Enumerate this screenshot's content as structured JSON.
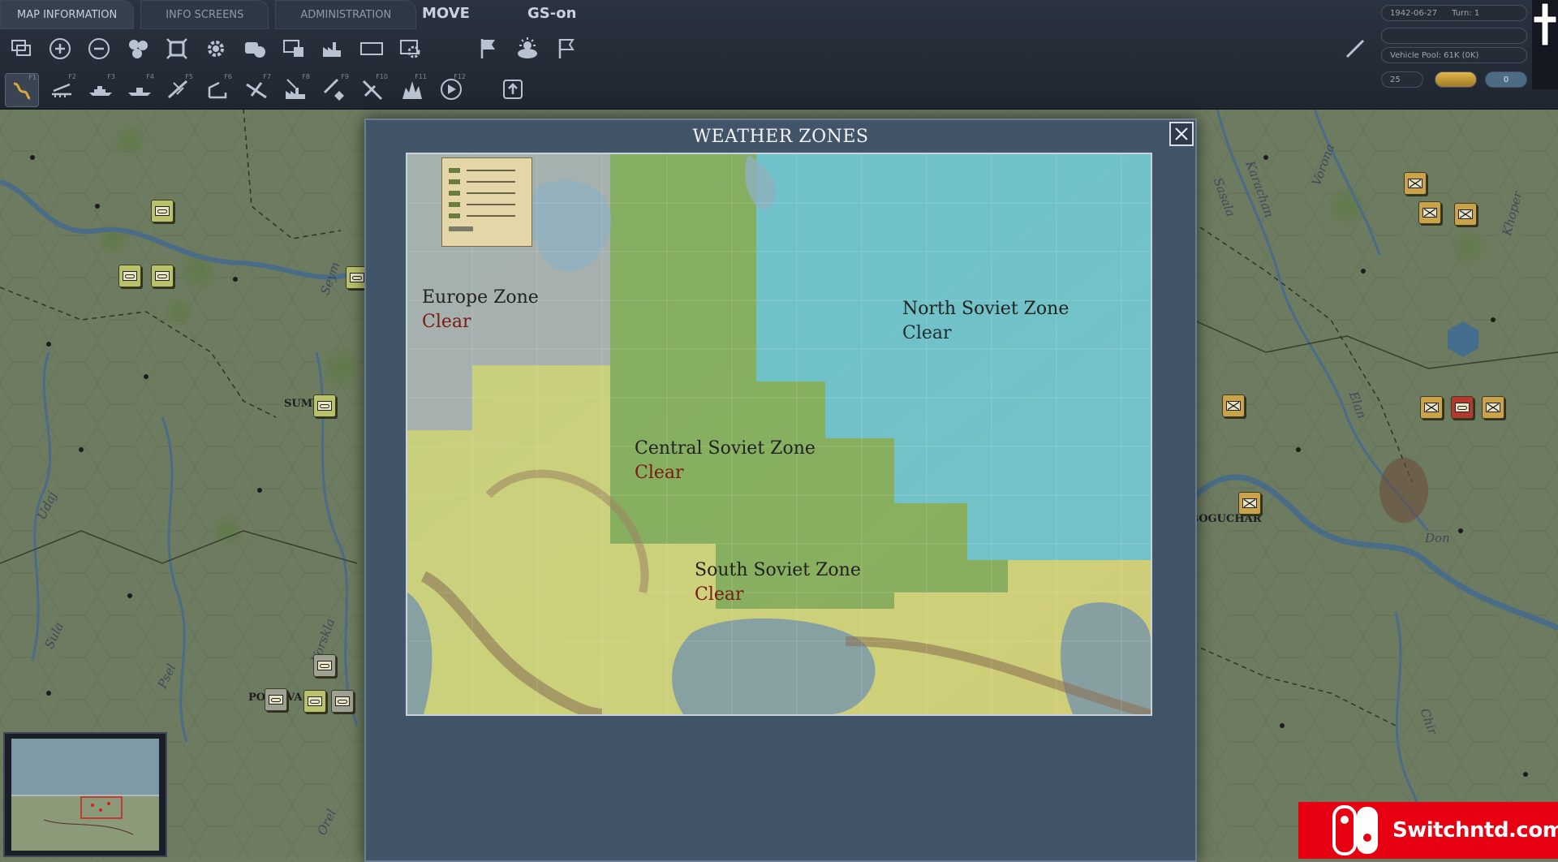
{
  "top_bar": {
    "tabs": [
      {
        "label": "MAP INFORMATION",
        "active": true
      },
      {
        "label": "INFO SCREENS",
        "active": false
      },
      {
        "label": "ADMINISTRATION",
        "active": false
      }
    ],
    "mode_labels": [
      "MOVE",
      "GS-on"
    ],
    "toolbar_row1_icons": [
      "select-icon",
      "zoom-in-icon",
      "zoom-out-icon",
      "hex-group-icon",
      "frame-icon",
      "gear-icon",
      "toggle-icon",
      "monitor-icon",
      "factory-icon",
      "rectangle-icon",
      "eye-gear-icon",
      "flag-move-icon",
      "weather-icon",
      "flag-icon",
      "pen-icon"
    ],
    "toolbar_row2": [
      {
        "icon": "ground-move-icon",
        "key": "F1"
      },
      {
        "icon": "rail-move-icon",
        "key": "F2"
      },
      {
        "icon": "naval-move-icon",
        "key": "F3"
      },
      {
        "icon": "naval-transport-icon",
        "key": "F4"
      },
      {
        "icon": "air-attack-icon",
        "key": "F5"
      },
      {
        "icon": "paradrop-icon",
        "key": "F6"
      },
      {
        "icon": "air-transport-icon",
        "key": "F7"
      },
      {
        "icon": "bomb-factory-icon",
        "key": "F8"
      },
      {
        "icon": "airfield-attack-icon",
        "key": "F9"
      },
      {
        "icon": "bomb-naval-icon",
        "key": "F10"
      },
      {
        "icon": "explosion-icon",
        "key": "F11"
      },
      {
        "icon": "recon-icon",
        "key": "F12"
      },
      {
        "icon": "upload-icon",
        "key": ""
      }
    ]
  },
  "status_panel": {
    "date": "1942-06-27",
    "turn": "Turn: 1",
    "vehicle_pool": "Vehicle Pool: 61K (0K)",
    "counter": "25",
    "small_value": "0"
  },
  "map": {
    "rivers": [
      "Seym",
      "Udaj",
      "Sula",
      "Psel",
      "Vorskla",
      "Orel",
      "Sasala",
      "Karachan",
      "Vorona",
      "Xopor",
      "Elan",
      "Don",
      "Chir",
      "Khoper"
    ],
    "river_labels_shown": [
      {
        "id": "seym",
        "text": "Seym"
      },
      {
        "id": "udaj",
        "text": "Udaj"
      },
      {
        "id": "sula",
        "text": "Sula"
      },
      {
        "id": "psel",
        "text": "Psel"
      },
      {
        "id": "vorskla",
        "text": "Vorskla"
      },
      {
        "id": "orel",
        "text": "Orel"
      },
      {
        "id": "sasala",
        "text": "Sasala"
      },
      {
        "id": "karachan",
        "text": "Karachan"
      },
      {
        "id": "vorona",
        "text": "Vorona"
      },
      {
        "id": "xopor",
        "text": "Khoper"
      },
      {
        "id": "elan",
        "text": "Elan"
      },
      {
        "id": "don",
        "text": "Don"
      },
      {
        "id": "chir",
        "text": "Chir"
      }
    ],
    "cities": [
      {
        "id": "sumy",
        "text": "SUMY"
      },
      {
        "id": "poltava",
        "text": "POLTAVA"
      },
      {
        "id": "boguchar",
        "text": "BOGUCHAR"
      }
    ]
  },
  "dialog": {
    "title": "WEATHER ZONES",
    "zones": [
      {
        "name": "Europe Zone",
        "condition": "Clear"
      },
      {
        "name": "North Soviet Zone",
        "condition": "Clear"
      },
      {
        "name": "Central Soviet Zone",
        "condition": "Clear"
      },
      {
        "name": "South Soviet Zone",
        "condition": "Clear"
      }
    ],
    "colors": {
      "europe": "#a8b2b8",
      "north": "#67c6d6",
      "central": "#7fae58",
      "south": "#d9dc7a",
      "condition_text": "#7a1a12"
    }
  },
  "watermark": {
    "text": "Switchntd.com"
  }
}
